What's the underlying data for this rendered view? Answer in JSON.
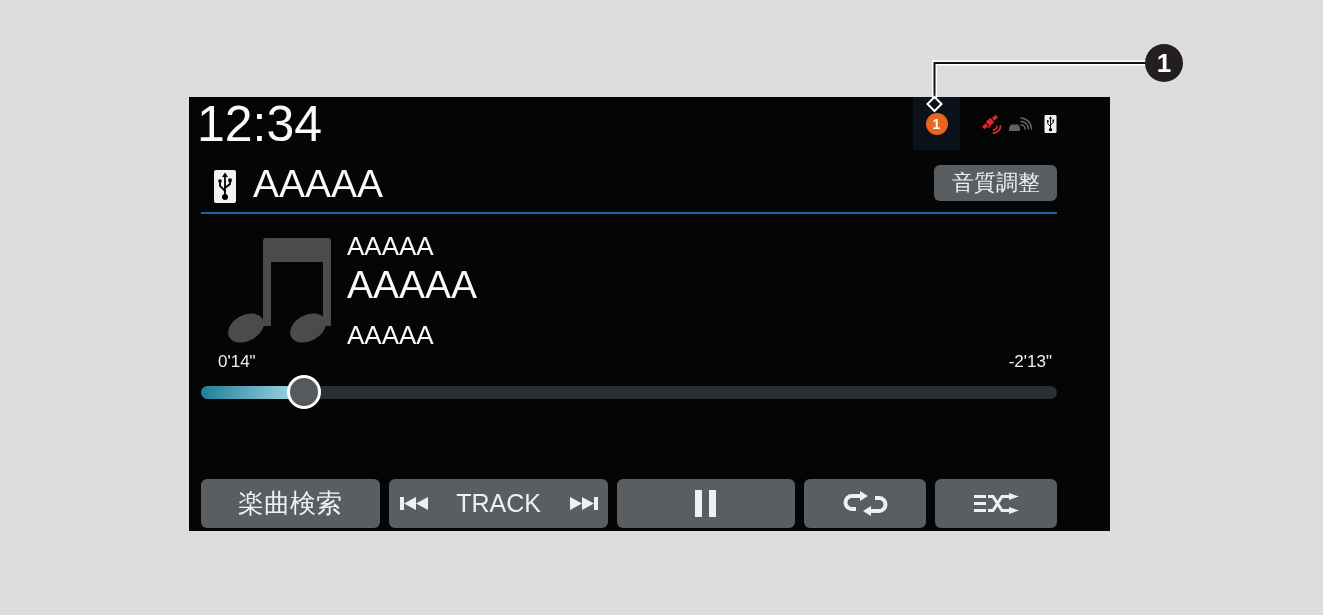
{
  "callout": {
    "number": "1"
  },
  "status_bar": {
    "clock": "12:34",
    "notification_count": "1"
  },
  "source": {
    "name": "AAAAA",
    "settings_button": "音質調整"
  },
  "track_info": [
    {
      "kind": "secondary",
      "text": "AAAAA"
    },
    {
      "kind": "primary",
      "text": "AAAAA"
    },
    {
      "kind": "secondary",
      "text": "AAAAA"
    }
  ],
  "progress": {
    "elapsed": "0'14\"",
    "remaining": "-2'13\"",
    "level": 0.12
  },
  "controls": [
    {
      "kind": "search",
      "label": "楽曲検索"
    },
    {
      "kind": "track",
      "label": "TRACK"
    },
    {
      "kind": "pause"
    },
    {
      "kind": "repeat"
    },
    {
      "kind": "shuffle"
    }
  ]
}
